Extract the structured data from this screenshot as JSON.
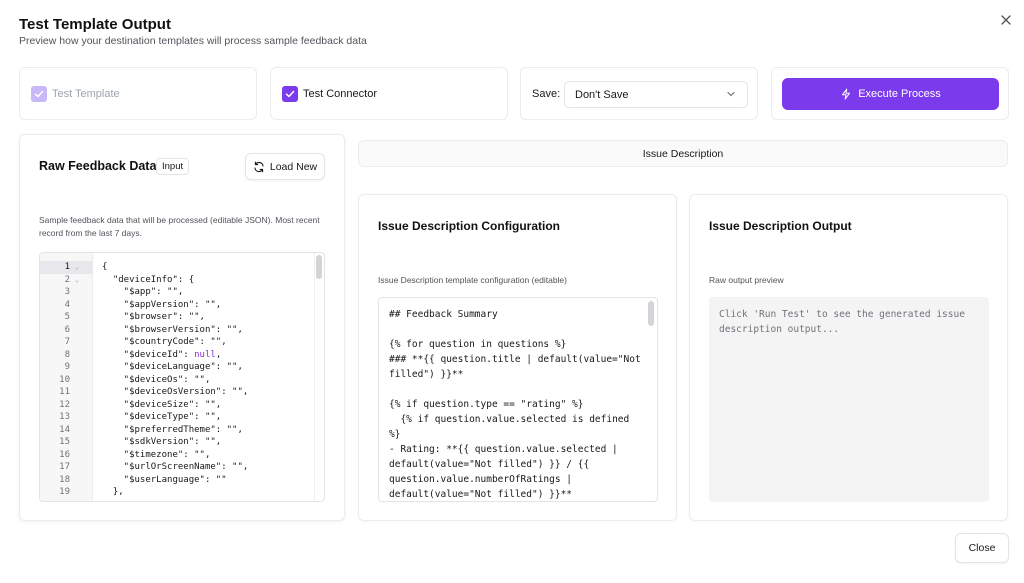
{
  "header": {
    "title": "Test Template Output",
    "subtitle": "Preview how your destination templates will process sample feedback data"
  },
  "options": {
    "test_template": {
      "label": "Test Template",
      "checked": true,
      "disabled": true
    },
    "test_connector": {
      "label": "Test Connector",
      "checked": true,
      "disabled": false
    },
    "save": {
      "label": "Save:",
      "selected": "Don't Save"
    },
    "execute_label": "Execute Process"
  },
  "raw_panel": {
    "title": "Raw Feedback Data",
    "badge": "Input",
    "load_label": "Load New",
    "description": "Sample feedback data that will be processed (editable JSON). Most recent record from the last 7 days.",
    "lines": [
      {
        "n": "1",
        "fold": "⌄",
        "code": "{"
      },
      {
        "n": "2",
        "fold": "⌄",
        "code": "  \"deviceInfo\": {"
      },
      {
        "n": "3",
        "fold": "",
        "code": "    \"$app\": \"\","
      },
      {
        "n": "4",
        "fold": "",
        "code": "    \"$appVersion\": \"\","
      },
      {
        "n": "5",
        "fold": "",
        "code": "    \"$browser\": \"\","
      },
      {
        "n": "6",
        "fold": "",
        "code": "    \"$browserVersion\": \"\","
      },
      {
        "n": "7",
        "fold": "",
        "code": "    \"$countryCode\": \"\","
      },
      {
        "n": "8",
        "fold": "",
        "code": "    \"$deviceId\": ",
        "null": "null",
        "tail": ","
      },
      {
        "n": "9",
        "fold": "",
        "code": "    \"$deviceLanguage\": \"\","
      },
      {
        "n": "10",
        "fold": "",
        "code": "    \"$deviceOs\": \"\","
      },
      {
        "n": "11",
        "fold": "",
        "code": "    \"$deviceOsVersion\": \"\","
      },
      {
        "n": "12",
        "fold": "",
        "code": "    \"$deviceSize\": \"\","
      },
      {
        "n": "13",
        "fold": "",
        "code": "    \"$deviceType\": \"\","
      },
      {
        "n": "14",
        "fold": "",
        "code": "    \"$preferredTheme\": \"\","
      },
      {
        "n": "15",
        "fold": "",
        "code": "    \"$sdkVersion\": \"\","
      },
      {
        "n": "16",
        "fold": "",
        "code": "    \"$timezone\": \"\","
      },
      {
        "n": "17",
        "fold": "",
        "code": "    \"$urlOrScreenName\": \"\","
      },
      {
        "n": "18",
        "fold": "",
        "code": "    \"$userLanguage\": \"\""
      },
      {
        "n": "19",
        "fold": "",
        "code": "  },"
      }
    ]
  },
  "tab": {
    "label": "Issue Description"
  },
  "config_panel": {
    "title": "Issue Description Configuration",
    "description": "Issue Description template configuration (editable)",
    "template": "## Feedback Summary\n\n{% for question in questions %}\n### **{{ question.title | default(value=\"Not filled\") }}**\n\n{% if question.type == \"rating\" %}\n  {% if question.value.selected is defined %}\n- Rating: **{{ question.value.selected | default(value=\"Not filled\") }} / {{ question.value.numberOfRatings | default(value=\"Not filled\") }}**"
  },
  "output_panel": {
    "title": "Issue Description Output",
    "description": "Raw output preview",
    "placeholder": "Click 'Run Test' to see the generated issue description output..."
  },
  "footer": {
    "close_label": "Close"
  },
  "colors": {
    "accent": "#7c3aed",
    "accent_disabled": "#c9b8f8",
    "null_token": "#8b2bd6"
  }
}
